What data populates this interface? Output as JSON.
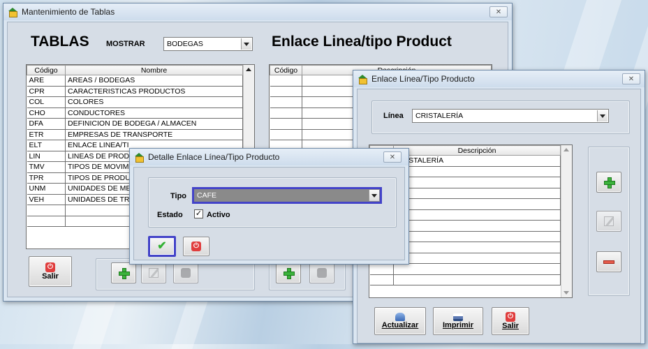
{
  "main_window": {
    "title": "Mantenimiento de Tablas",
    "close_label": "✕",
    "heading_left": "TABLAS",
    "mostrar_label": "MOSTRAR",
    "mostrar_value": "BODEGAS",
    "heading_right": "Enlace Linea/tipo Product",
    "tablas_grid": {
      "col_codigo": "Código",
      "col_nombre": "Nombre",
      "rows": [
        {
          "codigo": "ARE",
          "nombre": "AREAS / BODEGAS"
        },
        {
          "codigo": "CPR",
          "nombre": "CARACTERISTICAS PRODUCTOS"
        },
        {
          "codigo": "COL",
          "nombre": "COLORES"
        },
        {
          "codigo": "CHO",
          "nombre": "CONDUCTORES"
        },
        {
          "codigo": "DFA",
          "nombre": "DEFINICION DE BODEGA / ALMACEN"
        },
        {
          "codigo": "ETR",
          "nombre": "EMPRESAS DE TRANSPORTE"
        },
        {
          "codigo": "ELT",
          "nombre": "ENLACE LINEA/TI"
        },
        {
          "codigo": "LIN",
          "nombre": "LINEAS DE PRODU"
        },
        {
          "codigo": "TMV",
          "nombre": "TIPOS DE MOVIMI"
        },
        {
          "codigo": "TPR",
          "nombre": "TIPOS DE PRODUC"
        },
        {
          "codigo": "UNM",
          "nombre": "UNIDADES DE ME"
        },
        {
          "codigo": "VEH",
          "nombre": "UNIDADES DE TRA"
        }
      ]
    },
    "enlace_grid": {
      "col_codigo": "Código",
      "col_descripcion": "Descripción"
    },
    "salir_label": "Salir"
  },
  "enlace_window": {
    "title": "Enlace Línea/Tipo Producto",
    "close_label": "✕",
    "linea_label": "Línea",
    "linea_value": "CRISTALERÍA",
    "grid": {
      "col_descripcion": "Descripción",
      "first_row": "CRISTALERÍA"
    },
    "actualizar_label": "Actualizar",
    "imprimir_label": "Imprimir",
    "salir_label": "Salir"
  },
  "detalle_window": {
    "title": "Detalle Enlace Línea/Tipo Producto",
    "close_label": "✕",
    "tipo_label": "Tipo",
    "tipo_value": "CAFE",
    "estado_label": "Estado",
    "activo_label": "Activo",
    "activo_checked": true
  },
  "colors": {
    "highlight_border": "#4343c8",
    "selected_combo_bg": "#8a8a8a"
  }
}
